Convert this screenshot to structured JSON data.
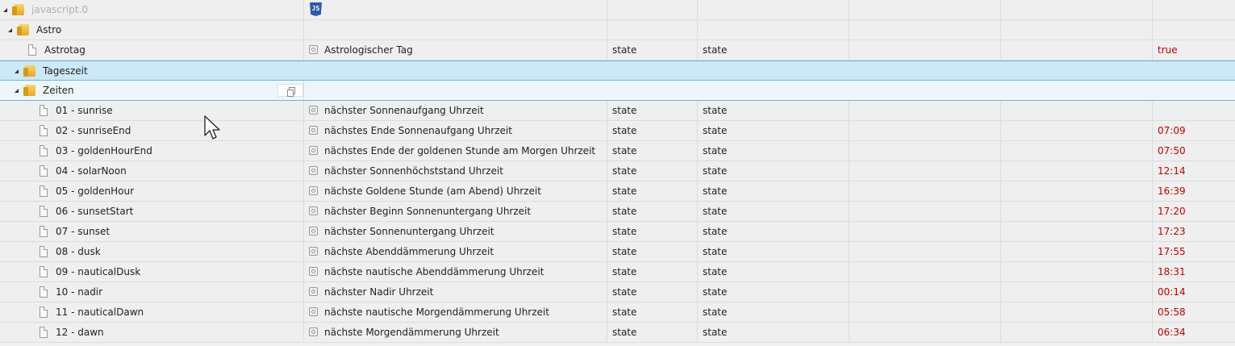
{
  "root": {
    "label": "javascript.0"
  },
  "astro": {
    "label": "Astro"
  },
  "astrotag": {
    "name": "Astrotag",
    "desc": "Astrologischer Tag",
    "type": "state",
    "role": "state",
    "value": "true"
  },
  "tageszeit": {
    "label": "Tageszeit"
  },
  "zeiten": {
    "label": "Zeiten"
  },
  "rows": [
    {
      "name": "01 - sunrise",
      "desc": "nächster Sonnenaufgang Uhrzeit",
      "type": "state",
      "role": "state",
      "value": ""
    },
    {
      "name": "02 - sunriseEnd",
      "desc": "nächstes Ende Sonnenaufgang Uhrzeit",
      "type": "state",
      "role": "state",
      "value": "07:09"
    },
    {
      "name": "03 - goldenHourEnd",
      "desc": "nächstes Ende der goldenen Stunde am Morgen Uhrzeit",
      "type": "state",
      "role": "state",
      "value": "07:50"
    },
    {
      "name": "04 - solarNoon",
      "desc": "nächster Sonnenhöchststand Uhrzeit",
      "type": "state",
      "role": "state",
      "value": "12:14"
    },
    {
      "name": "05 - goldenHour",
      "desc": "nächste Goldene Stunde (am Abend) Uhrzeit",
      "type": "state",
      "role": "state",
      "value": "16:39"
    },
    {
      "name": "06 - sunsetStart",
      "desc": "nächster Beginn Sonnenuntergang Uhrzeit",
      "type": "state",
      "role": "state",
      "value": "17:20"
    },
    {
      "name": "07 - sunset",
      "desc": "nächster Sonnenuntergang Uhrzeit",
      "type": "state",
      "role": "state",
      "value": "17:23"
    },
    {
      "name": "08 - dusk",
      "desc": "nächste Abenddämmerung Uhrzeit",
      "type": "state",
      "role": "state",
      "value": "17:55"
    },
    {
      "name": "09 - nauticalDusk",
      "desc": "nächste nautische Abenddämmerung Uhrzeit",
      "type": "state",
      "role": "state",
      "value": "18:31"
    },
    {
      "name": "10 - nadir",
      "desc": "nächster Nadir Uhrzeit",
      "type": "state",
      "role": "state",
      "value": "00:14"
    },
    {
      "name": "11 - nauticalDawn",
      "desc": "nächste nautische Morgendämmerung Uhrzeit",
      "type": "state",
      "role": "state",
      "value": "05:58"
    },
    {
      "name": "12 - dawn",
      "desc": "nächste Morgendämmerung Uhrzeit",
      "type": "state",
      "role": "state",
      "value": "06:34"
    }
  ],
  "icons": {
    "folder": "folder-icon",
    "file": "file-icon",
    "state": "state-icon",
    "js": "js-icon",
    "copy": "copy-icon"
  },
  "colors": {
    "value": "#c00000",
    "selected_bg": "#cde8f6",
    "selected_border": "#6ab7df"
  }
}
